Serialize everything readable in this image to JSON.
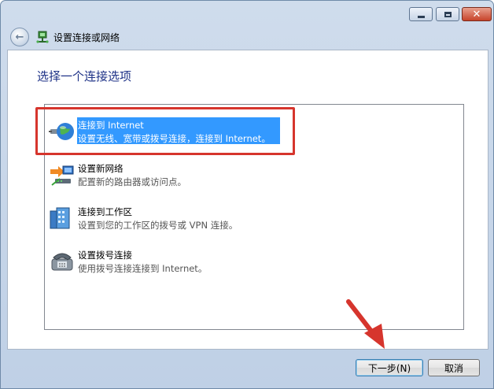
{
  "window": {
    "title": "设置连接或网络",
    "controls": {
      "minimize": "minimize",
      "maximize": "maximize",
      "close": "✕"
    }
  },
  "main": {
    "heading": "选择一个连接选项",
    "options": [
      {
        "title": "连接到 Internet",
        "desc": "设置无线、宽带或拨号连接，连接到 Internet。",
        "icon": "globe-connection-icon",
        "selected": true
      },
      {
        "title": "设置新网络",
        "desc": "配置新的路由器或访问点。",
        "icon": "new-network-icon",
        "selected": false
      },
      {
        "title": "连接到工作区",
        "desc": "设置到您的工作区的拨号或 VPN 连接。",
        "icon": "workplace-icon",
        "selected": false
      },
      {
        "title": "设置拨号连接",
        "desc": "使用拨号连接连接到 Internet。",
        "icon": "dialup-phone-icon",
        "selected": false
      }
    ]
  },
  "footer": {
    "next_label": "下一步(N)",
    "cancel_label": "取消"
  },
  "colors": {
    "selection": "#3399ff",
    "annotation": "#d6352d",
    "heading": "#1e3287"
  }
}
